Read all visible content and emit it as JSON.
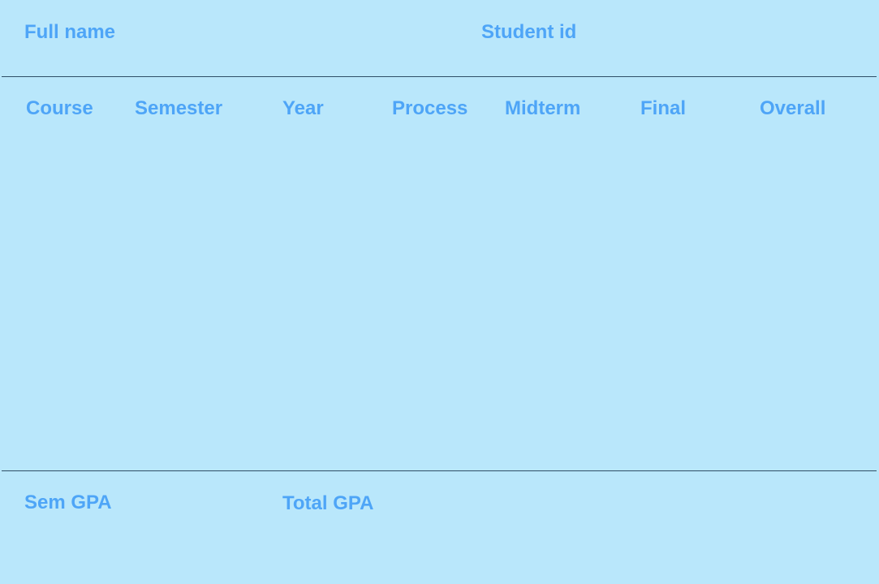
{
  "header": {
    "full_name_label": "Full name",
    "student_id_label": "Student id"
  },
  "table": {
    "columns": [
      "Course",
      "Semester",
      "Year",
      "Process",
      "Midterm",
      "Final",
      "Overall"
    ],
    "rows": []
  },
  "footer": {
    "sem_gpa_label": "Sem GPA",
    "total_gpa_label": "Total GPA"
  },
  "colors": {
    "background": "#b9e7fb",
    "label_text": "#4ea5f7",
    "divider": "#2f4f66"
  }
}
